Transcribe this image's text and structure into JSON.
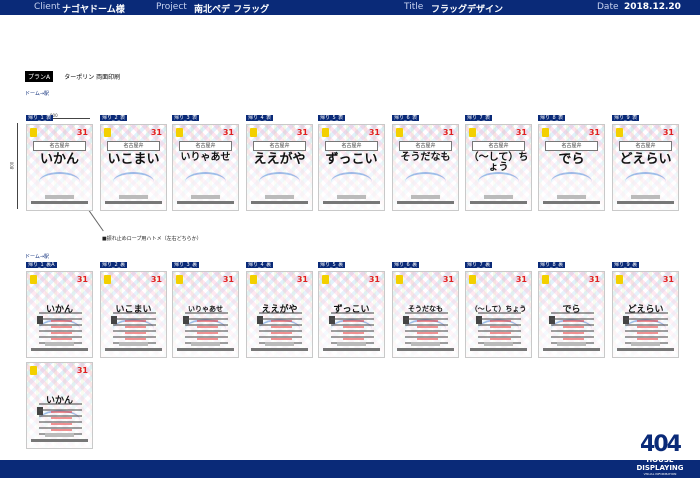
{
  "header": {
    "client_label": "Client",
    "client": "ナゴヤドーム様",
    "project_label": "Project",
    "project": "南北ペデ フラッグ",
    "title_label": "Title",
    "title": "フラッグデザイン",
    "date_label": "Date",
    "date": "2018.12.20"
  },
  "plan": {
    "tag": "プランA",
    "desc": "ターポリン 両面印刷"
  },
  "groups": [
    "ドーム→駅",
    "ドーム→駅"
  ],
  "dims": {
    "width": "900",
    "height": "800"
  },
  "note": "■振れ止めロープ用ハトメ（左右どちらか）",
  "row1": {
    "labels": [
      "帰り_1_表",
      "帰り_2_表",
      "帰り_3_表",
      "帰り_4_表",
      "帰り_5_表",
      "帰り_6_表",
      "帰り_7_表",
      "帰り_8_表",
      "帰り_9_表"
    ],
    "words": [
      "いかん",
      "いこまい",
      "いりゃあせ",
      "ええがや",
      "ずっこい",
      "そうだなも",
      "（〜して）ちょう",
      "でら",
      "どえらい"
    ],
    "subtitle": "名古屋弁"
  },
  "row2": {
    "labels": [
      "帰り_1_裏A",
      "帰り_2_裏",
      "帰り_3_裏",
      "帰り_4_裏",
      "帰り_5_裏",
      "帰り_6_裏",
      "帰り_7_裏",
      "帰り_8_裏",
      "帰り_9_裏"
    ],
    "words": [
      "いかん",
      "いこまい",
      "いりゃあせ",
      "ええがや",
      "ずっこい",
      "そうだなも",
      "（〜して）ちょう",
      "でら",
      "どえらい"
    ]
  },
  "row3": {
    "label": "帰り_1_裏B",
    "word": "いかん"
  },
  "brand": {
    "number": "404",
    "line1": "HOUSE",
    "line2": "DISPLAYING",
    "line3": "VISUAL INFORMATION"
  },
  "badge": "31"
}
